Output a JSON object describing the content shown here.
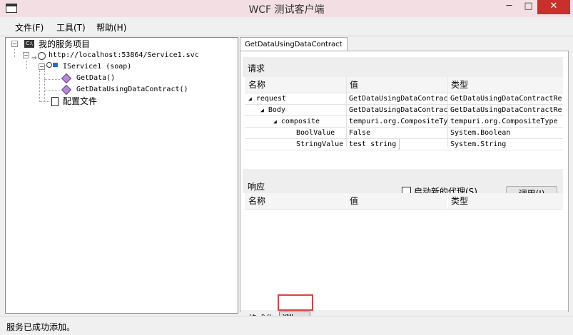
{
  "window": {
    "title": "WCF 测试客户端",
    "min_glyph": "─",
    "max_glyph": "□",
    "close_glyph": "✕"
  },
  "menu": {
    "file": "文件(F)",
    "tools": "工具(T)",
    "help": "帮助(H)"
  },
  "tree": {
    "root": "我的服务项目",
    "endpoint": "http://localhost:53864/Service1.svc",
    "contract": "IService1 (soap)",
    "op1": "GetData()",
    "op2": "GetDataUsingDataContract()",
    "config": "配置文件"
  },
  "tab": {
    "label": "GetDataUsingDataContract"
  },
  "request": {
    "heading": "请求",
    "columns": [
      "名称",
      "值",
      "类型"
    ],
    "rows": [
      {
        "name": "request",
        "value": "GetDataUsingDataContract",
        "type": "GetDataUsingDataContractRe"
      },
      {
        "name": "Body",
        "value": "GetDataUsingDataContract",
        "type": "GetDataUsingDataContractRe"
      },
      {
        "name": "composite",
        "value": "tempuri.org.CompositeTyp",
        "type": "tempuri.org.CompositeType"
      },
      {
        "name": "BoolValue",
        "value": "False",
        "type": "System.Boolean"
      },
      {
        "name": "StringValue",
        "value": "test string",
        "type": "System.String"
      }
    ]
  },
  "response": {
    "heading": "响应",
    "columns": [
      "名称",
      "值",
      "类型"
    ],
    "new_proxy_label": "启动新的代理(S)",
    "invoke_label": "调用(I)"
  },
  "bottom_tabs": {
    "formatted": "格式化",
    "xml": "XML"
  },
  "status": {
    "text": "服务已成功添加。"
  },
  "colors": {
    "titlebar": "#f3dfe3",
    "close": "#c7302b",
    "highlight": "#d9443f"
  }
}
